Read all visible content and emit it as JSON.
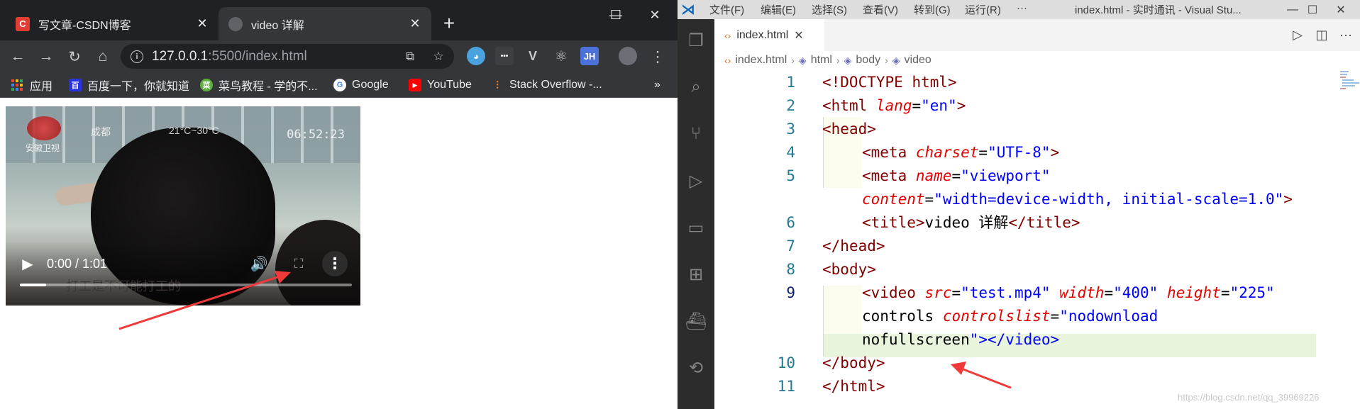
{
  "browser": {
    "tabs": [
      {
        "title": "写文章-CSDN博客",
        "favicon": "C",
        "active": false
      },
      {
        "title": "video 详解",
        "favicon": "",
        "active": true
      }
    ],
    "new_tab": "+",
    "window_controls": {
      "minimize": "—",
      "maximize": "☐",
      "close": "✕"
    },
    "url_host": "127.0.0.1",
    "url_rest": ":5500/index.html",
    "bookmarks": [
      {
        "label": "应用",
        "icon": "apps-icon"
      },
      {
        "label": "百度一下，你就知道",
        "icon": "baidu-icon"
      },
      {
        "label": "菜鸟教程 - 学的不...",
        "icon": "runoob-icon"
      },
      {
        "label": "Google",
        "icon": "google-icon"
      },
      {
        "label": "YouTube",
        "icon": "youtube-icon"
      },
      {
        "label": "Stack Overflow -...",
        "icon": "stackoverflow-icon"
      }
    ],
    "bookmarks_more": "»",
    "extensions": [
      {
        "name": "colorful-ext-icon",
        "glyph": "◕"
      },
      {
        "name": "dots-ext-icon",
        "glyph": "•••"
      },
      {
        "name": "vue-devtools-icon",
        "glyph": "V"
      },
      {
        "name": "react-devtools-icon",
        "glyph": "⚛"
      },
      {
        "name": "jh-ext-icon",
        "glyph": "JH"
      }
    ],
    "video": {
      "channel_text": "安徽卫视",
      "top_text": "成都",
      "temp_text": "21°C~30°C",
      "timestamp": "06:52:23",
      "subtitle": "打工是不可能打工的",
      "time_display": "0:00 / 1:01",
      "progress": 0.08
    }
  },
  "vscode": {
    "menu": [
      "文件(F)",
      "编辑(E)",
      "选择(S)",
      "查看(V)",
      "转到(G)",
      "运行(R)",
      "···"
    ],
    "window_title": "index.html - 实时通讯 - Visual Stu...",
    "tab": {
      "label": "index.html",
      "close": "✕"
    },
    "breadcrumbs": [
      "index.html",
      "html",
      "body",
      "video"
    ],
    "lines": [
      {
        "num": "1",
        "text": "<!DOCTYPE html>"
      },
      {
        "num": "2",
        "text": "<html lang=\"en\">"
      },
      {
        "num": "3",
        "text": "<head>"
      },
      {
        "num": "4",
        "text": "<meta charset=\"UTF-8\">"
      },
      {
        "num": "5",
        "text": "<meta name=\"viewport\""
      },
      {
        "num": "",
        "text": "content=\"width=device-width, initial-scale=1.0\">"
      },
      {
        "num": "6",
        "text": "<title>video 详解</title>"
      },
      {
        "num": "7",
        "text": "</head>"
      },
      {
        "num": "8",
        "text": "<body>"
      },
      {
        "num": "9",
        "text": "<video src=\"test.mp4\" width=\"400\" height=\"225\""
      },
      {
        "num": "",
        "text": "controls controlslist=\"nodownload"
      },
      {
        "num": "",
        "text": "nofullscreen\"></video>"
      },
      {
        "num": "10",
        "text": "</body>"
      },
      {
        "num": "11",
        "text": "</html>"
      }
    ]
  },
  "watermark": "https://blog.csdn.net/qq_39969226",
  "colors": {
    "chrome_dark": "#202124",
    "chrome_toolbar": "#35363a",
    "vscode_tag": "#800000",
    "vscode_attr": "#ff0000",
    "vscode_string": "#0000ff",
    "annotation_arrow": "#f03a3a"
  }
}
